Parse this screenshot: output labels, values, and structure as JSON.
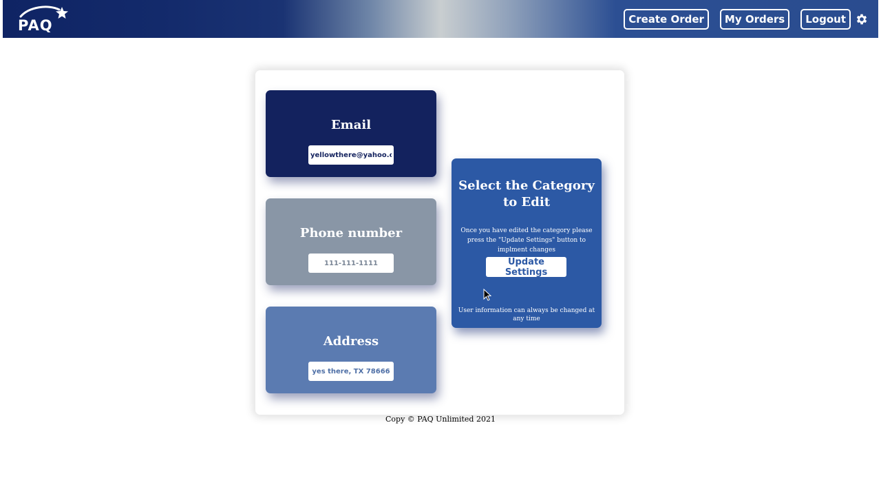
{
  "header": {
    "logo_text": "PAQ",
    "nav": {
      "create_order": "Create Order",
      "my_orders": "My Orders",
      "logout": "Logout"
    },
    "settings_icon": "gear-icon"
  },
  "cards": {
    "email": {
      "title": "Email",
      "value": "yellowthere@yahoo.com"
    },
    "phone": {
      "title": "Phone number",
      "value": "111-111-1111"
    },
    "address": {
      "title": "Address",
      "value": "yes there, TX 78666"
    }
  },
  "edit_panel": {
    "title": "Select the Category to Edit",
    "hint": "Once you have edited the category please press the \"Update Settings\" button to implment changes",
    "button_label": "Update Settings",
    "note": "User information can always be changed at any time"
  },
  "footer": {
    "text": "Copy © PAQ Unlimited 2021"
  },
  "colors": {
    "navy": "#13225e",
    "gray": "#8996a6",
    "steel_blue": "#5b7bb1",
    "royal_blue": "#2c59a5"
  }
}
